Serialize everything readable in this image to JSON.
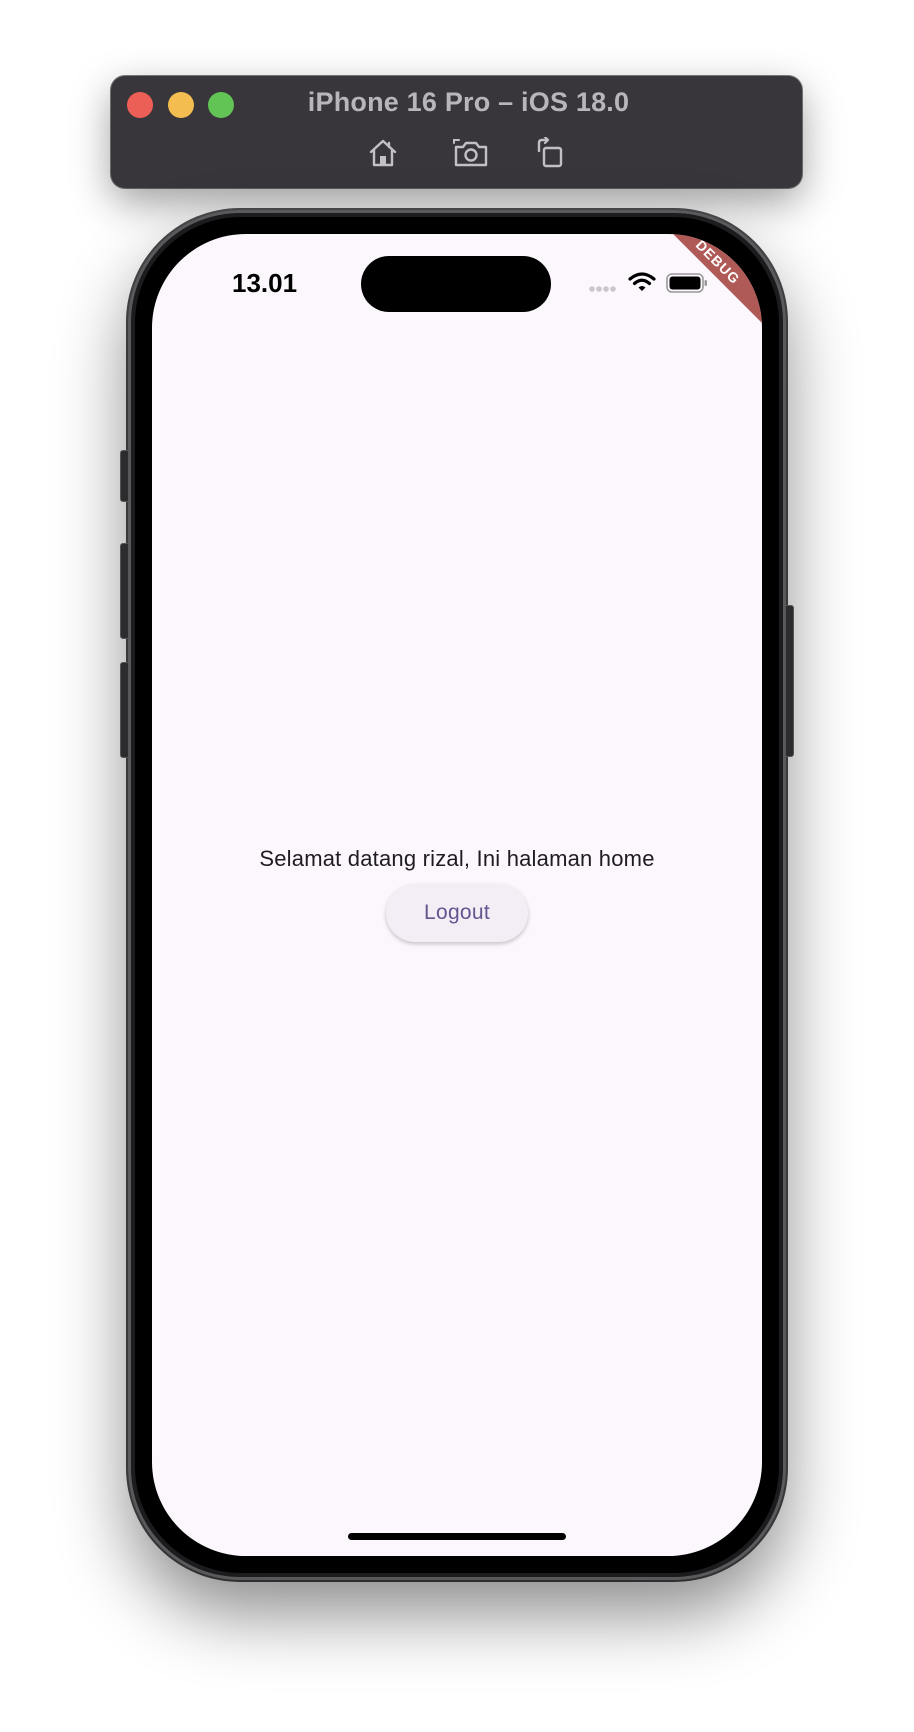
{
  "simulator": {
    "title": "iPhone 16 Pro – iOS 18.0",
    "toolbar_icons": [
      "home-icon",
      "screenshot-camera-icon",
      "rotate-icon"
    ]
  },
  "status_bar": {
    "time": "13.01",
    "icons": [
      "signal-icon",
      "wifi-icon",
      "battery-icon"
    ]
  },
  "debug_banner": "DEBUG",
  "home_screen": {
    "welcome_text": "Selamat datang rizal, Ini halaman home",
    "logout_label": "Logout"
  },
  "colors": {
    "screen_background": "#fcf7fd",
    "button_background": "#f3edf6",
    "button_text": "#65558f",
    "debug_banner": "#a3403c"
  }
}
